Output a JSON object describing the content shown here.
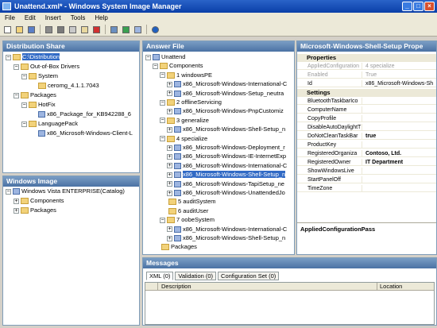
{
  "window": {
    "title": "Unattend.xml* - Windows System Image Manager"
  },
  "menu": [
    "File",
    "Edit",
    "Insert",
    "Tools",
    "Help"
  ],
  "toolbar": [
    "new-icon",
    "open-icon",
    "save-icon",
    "print-icon",
    "cut-icon",
    "copy-icon",
    "paste-icon",
    "delete-icon",
    "find-icon",
    "validate-icon",
    "component-icon",
    "help-icon"
  ],
  "dist": {
    "title": "Distribution Share",
    "items": [
      {
        "label": "C:\\Distribution",
        "icon": "folder",
        "lvl": 0,
        "exp": "-",
        "sel": true
      },
      {
        "label": "Out-of-Box Drivers",
        "icon": "folder",
        "lvl": 1,
        "exp": "-"
      },
      {
        "label": "System",
        "icon": "folder",
        "lvl": 2,
        "exp": "-"
      },
      {
        "label": "ceromg_4.1.1.7043",
        "icon": "folder",
        "lvl": 3,
        "exp": ""
      },
      {
        "label": "Packages",
        "icon": "folder",
        "lvl": 1,
        "exp": "-"
      },
      {
        "label": "HotFix",
        "icon": "folder",
        "lvl": 2,
        "exp": "-"
      },
      {
        "label": "x86_Package_for_KB942288_6",
        "icon": "comp",
        "lvl": 3,
        "exp": ""
      },
      {
        "label": "LanguagePack",
        "icon": "folder",
        "lvl": 2,
        "exp": "-"
      },
      {
        "label": "x86_Microsoft-Windows-Client-L",
        "icon": "comp",
        "lvl": 3,
        "exp": ""
      }
    ]
  },
  "image": {
    "title": "Windows Image",
    "items": [
      {
        "label": "Windows Vista ENTERPRISE(Catalog)",
        "icon": "comp",
        "lvl": 0,
        "exp": "-"
      },
      {
        "label": "Components",
        "icon": "folder",
        "lvl": 1,
        "exp": "+"
      },
      {
        "label": "Packages",
        "icon": "folder",
        "lvl": 1,
        "exp": "+"
      }
    ]
  },
  "answer": {
    "title": "Answer File",
    "items": [
      {
        "label": "Unattend",
        "icon": "comp",
        "lvl": 0,
        "exp": "-"
      },
      {
        "label": "Components",
        "icon": "folder",
        "lvl": 1,
        "exp": "-"
      },
      {
        "label": "1 windowsPE",
        "icon": "folder",
        "lvl": 2,
        "exp": "-"
      },
      {
        "label": "x86_Microsoft-Windows-International-C",
        "icon": "comp",
        "lvl": 3,
        "exp": "+"
      },
      {
        "label": "x86_Microsoft-Windows-Setup_neutra",
        "icon": "comp",
        "lvl": 3,
        "exp": "+"
      },
      {
        "label": "2 offlineServicing",
        "icon": "folder",
        "lvl": 2,
        "exp": "-"
      },
      {
        "label": "x86_Microsoft-Windows-PnpCustomiz",
        "icon": "comp",
        "lvl": 3,
        "exp": "+"
      },
      {
        "label": "3 generalize",
        "icon": "folder",
        "lvl": 2,
        "exp": "-"
      },
      {
        "label": "x86_Microsoft-Windows-Shell-Setup_n",
        "icon": "comp",
        "lvl": 3,
        "exp": "+"
      },
      {
        "label": "4 specialize",
        "icon": "folder",
        "lvl": 2,
        "exp": "-"
      },
      {
        "label": "x86_Microsoft-Windows-Deployment_r",
        "icon": "comp",
        "lvl": 3,
        "exp": "+"
      },
      {
        "label": "x86_Microsoft-Windows-IE-InternetExp",
        "icon": "comp",
        "lvl": 3,
        "exp": "+"
      },
      {
        "label": "x86_Microsoft-Windows-International-C",
        "icon": "comp",
        "lvl": 3,
        "exp": "+"
      },
      {
        "label": "x86_Microsoft-Windows-Shell-Setup_n",
        "icon": "comp",
        "lvl": 3,
        "exp": "+",
        "sel": true
      },
      {
        "label": "x86_Microsoft-Windows-TapiSetup_ne",
        "icon": "comp",
        "lvl": 3,
        "exp": "+"
      },
      {
        "label": "x86_Microsoft-Windows-UnattendedJo",
        "icon": "comp",
        "lvl": 3,
        "exp": "+"
      },
      {
        "label": "5 auditSystem",
        "icon": "folder",
        "lvl": 2,
        "exp": ""
      },
      {
        "label": "6 auditUser",
        "icon": "folder",
        "lvl": 2,
        "exp": ""
      },
      {
        "label": "7 oobeSystem",
        "icon": "folder",
        "lvl": 2,
        "exp": "-"
      },
      {
        "label": "x86_Microsoft-Windows-International-C",
        "icon": "comp",
        "lvl": 3,
        "exp": "+"
      },
      {
        "label": "x86_Microsoft-Windows-Shell-Setup_n",
        "icon": "comp",
        "lvl": 3,
        "exp": "+"
      },
      {
        "label": "Packages",
        "icon": "folder",
        "lvl": 1,
        "exp": ""
      }
    ]
  },
  "props": {
    "title": "Microsoft-Windows-Shell-Setup Prope",
    "cat1": "Properties",
    "cat2": "Settings",
    "rows1": [
      {
        "k": "AppliedConfiguration",
        "v": "4 specialize",
        "gray": true
      },
      {
        "k": "Enabled",
        "v": "True",
        "gray": true
      },
      {
        "k": "Id",
        "v": "x86_Microsoft-Windows-Sh",
        "gray": false
      }
    ],
    "rows2": [
      {
        "k": "BluetoothTaskbarIco",
        "v": "",
        "bold": false
      },
      {
        "k": "ComputerName",
        "v": "",
        "bold": false
      },
      {
        "k": "CopyProfile",
        "v": "",
        "bold": false
      },
      {
        "k": "DisableAutoDaylightT",
        "v": "",
        "bold": false
      },
      {
        "k": "DoNotCleanTaskBar",
        "v": "true",
        "bold": true
      },
      {
        "k": "ProductKey",
        "v": "",
        "bold": false
      },
      {
        "k": "RegisteredOrganiza",
        "v": "Contoso, Ltd.",
        "bold": true
      },
      {
        "k": "RegisteredOwner",
        "v": "IT Department",
        "bold": true
      },
      {
        "k": "ShowWindowsLive",
        "v": "",
        "bold": false
      },
      {
        "k": "StartPanelOff",
        "v": "",
        "bold": false
      },
      {
        "k": "TimeZone",
        "v": "",
        "bold": false
      }
    ],
    "desc": "AppliedConfigurationPass"
  },
  "messages": {
    "title": "Messages",
    "tabs": [
      "XML (0)",
      "Validation (0)",
      "Configuration Set (0)"
    ],
    "col_desc": "Description",
    "col_loc": "Location"
  }
}
